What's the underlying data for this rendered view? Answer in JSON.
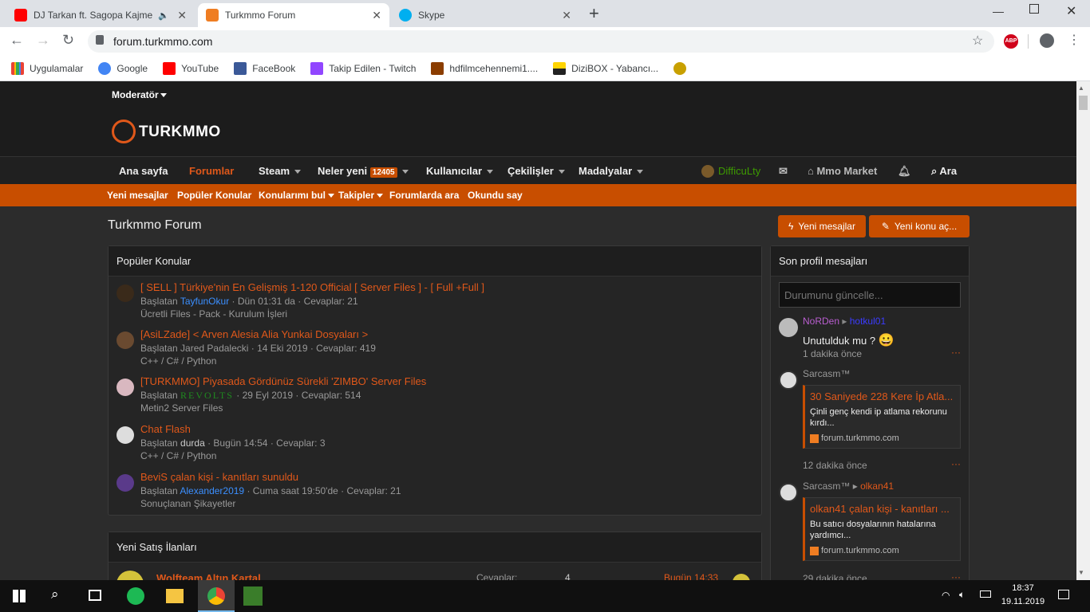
{
  "browser": {
    "tabs": [
      {
        "title": "DJ Tarkan ft. Sagopa Kajmer",
        "active": false
      },
      {
        "title": "Turkmmo Forum",
        "active": true
      },
      {
        "title": "Skype",
        "active": false
      }
    ],
    "url": "forum.turkmmo.com",
    "bookmarks": [
      "Uygulamalar",
      "Google",
      "YouTube",
      "FaceBook",
      "Takip Edilen - Twitch",
      "hdfilmcehennemi1....",
      "DiziBOX - Yabancı...",
      ""
    ]
  },
  "site": {
    "moderator_label": "Moderatör",
    "logo_text": "TURKMMO",
    "nav": {
      "home": "Ana sayfa",
      "forums": "Forumlar",
      "steam": "Steam",
      "whats_new": "Neler yeni",
      "whats_new_badge": "12405",
      "users": "Kullanıcılar",
      "giveaways": "Çekilişler",
      "medals": "Madalyalar",
      "user": "DifficuLty",
      "market": "Mmo Market",
      "search": "Ara"
    },
    "subnav": [
      "Yeni mesajlar",
      "Popüler Konular",
      "Konularımı bul",
      "Takipler",
      "Forumlarda ara",
      "Okundu say"
    ],
    "page_title": "Turkmmo Forum",
    "btn_new_posts": "Yeni mesajlar",
    "btn_new_thread": "Yeni konu aç...",
    "popular": {
      "header": "Popüler Konular",
      "started_by": "Başlatan",
      "threads": [
        {
          "title": "[ SELL ] Türkiye'nin En Gelişmiş 1-120 Official [ Server Files ] - [ Full +Full ]",
          "author": "TayfunOkur",
          "date": "Dün 01:31 da",
          "replies": "Cevaplar: 21",
          "category": "Ücretli Files - Pack - Kurulum İşleri"
        },
        {
          "title": "[AsiLZade] < Arven Alesia Alia Yunkai Dosyaları >",
          "author": "Jared Padalecki",
          "date": "14 Eki 2019",
          "replies": "Cevaplar: 419",
          "category": "C++ / C# / Python"
        },
        {
          "title": "[TURKMMO] Piyasada Gördünüz Sürekli 'ZIMBO' Server Files",
          "author": "REVOLTS",
          "date": "29 Eyl 2019",
          "replies": "Cevaplar: 514",
          "category": "Metin2 Server Files"
        },
        {
          "title": "Chat Flash",
          "author": "durda",
          "date": "Bugün 14:54",
          "replies": "Cevaplar: 3",
          "category": "C++ / C# / Python"
        },
        {
          "title": "BeviS çalan kişi - kanıtları sunuldu",
          "author": "Alexander2019",
          "date": "Cuma saat 19:50'de",
          "replies": "Cevaplar: 21",
          "category": "Sonuçlanan Şikayetler"
        }
      ]
    },
    "sales": {
      "header": "Yeni Satış İlanları",
      "first_title": "Wolfteam Altın Kartal",
      "replies_label": "Cevaplar:",
      "replies_value": "4",
      "time": "Bugün 14:33"
    },
    "profile_posts": {
      "header": "Son profil mesajları",
      "status_placeholder": "Durumunu güncelle...",
      "posts": [
        {
          "from": "NoRDen",
          "to": "hotkul01",
          "text": "Unutulduk mu ?",
          "emoji": "😀",
          "time": "1 dakika önce"
        },
        {
          "from": "Sarcasm™",
          "quote_title": "30 Saniyede 228 Kere İp Atla...",
          "quote_text": "Çinli genç kendi ip atlama rekorunu kırdı...",
          "quote_source": "forum.turkmmo.com",
          "time": "12 dakika önce"
        },
        {
          "from": "Sarcasm™",
          "to": "olkan41",
          "quote_title": "olkan41 çalan kişi - kanıtları ...",
          "quote_text": "Bu satıcı dosyalarının hatalarına yardımcı...",
          "quote_source": "forum.turkmmo.com",
          "time": "29 dakika önce"
        }
      ],
      "more": "···"
    }
  },
  "taskbar": {
    "time": "18:37",
    "date": "19.11.2019"
  },
  "colors": {
    "accent": "#c84e00",
    "link_orange": "#e0581a",
    "blue_user": "#3b8fff"
  }
}
